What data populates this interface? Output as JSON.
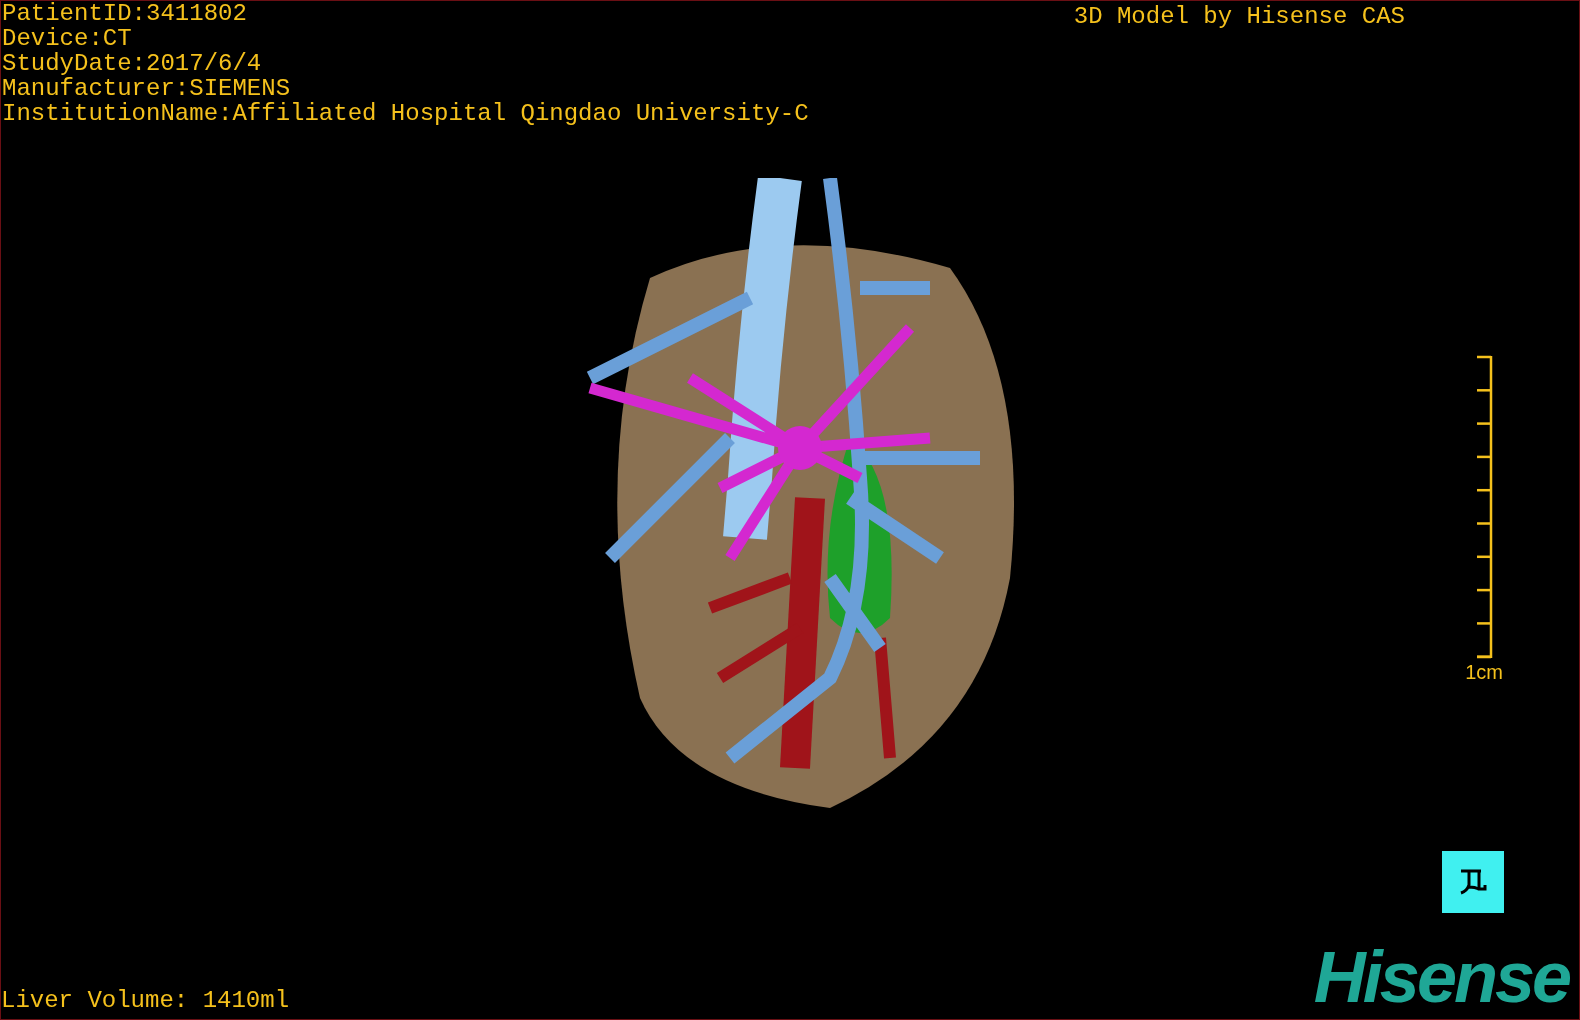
{
  "info_lines": [
    "PatientID:3411802",
    "Device:CT",
    "StudyDate:2017/6/4",
    "Manufacturer:SIEMENS",
    "InstitutionName:Affiliated Hospital Qingdao University-C"
  ],
  "title": "3D Model by Hisense CAS",
  "scale_bar": {
    "label": "1cm"
  },
  "liver_volume": "Liver Volume: 1410ml",
  "logo": "Hisense"
}
